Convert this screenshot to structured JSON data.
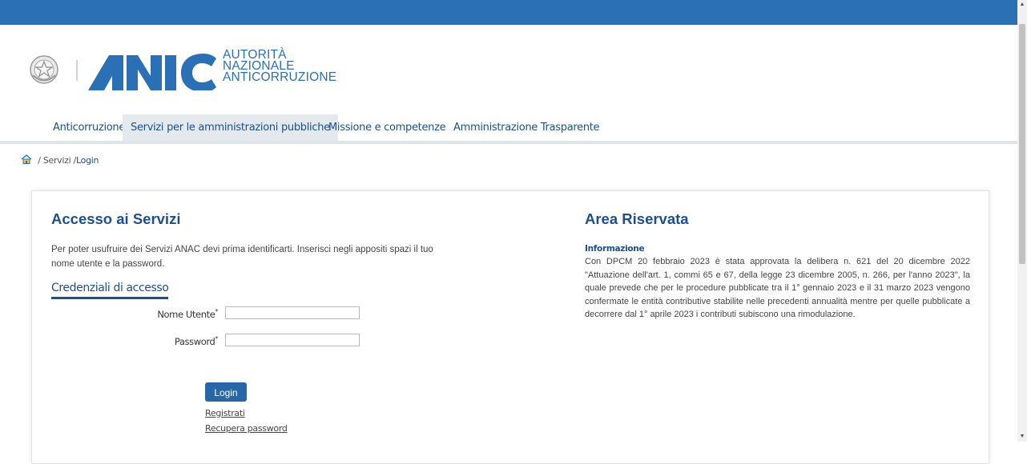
{
  "logo": {
    "brand": "ANAC",
    "line1": "AUTORITÀ",
    "line2": "NAZIONALE",
    "line3": "ANTICORRUZIONE",
    "brand_color": "#2b6fb5"
  },
  "nav": {
    "items": [
      {
        "label": "Anticorruzione"
      },
      {
        "label": "Servizi per le amministrazioni pubbliche"
      },
      {
        "label": "Missione e competenze"
      },
      {
        "label": "Amministrazione Trasparente"
      }
    ],
    "active_index": 1
  },
  "breadcrumb": {
    "home_icon": "home-icon",
    "sep1": "/",
    "item1": "Servizi",
    "sep2": "/",
    "item2": "Login"
  },
  "login": {
    "title": "Accesso ai Servizi",
    "intro": "Per poter usufruire dei Servizi ANAC devi prima identificarti. Inserisci negli appositi spazi il tuo nome utente e la password.",
    "credentials_title": "Credenziali di accesso",
    "username_label": "Nome Utente",
    "password_label": "Password",
    "required_mark": "*",
    "username_value": "",
    "password_value": "",
    "login_button": "Login",
    "register_link": "Registrati",
    "recover_link": "Recupera password"
  },
  "reserved": {
    "title": "Area Riservata",
    "info_label": "Informazione",
    "info_text": "Con DPCM 20 febbraio 2023 è stata approvata la delibera n. 621 del 20 dicembre 2022 \"Attuazione dell'art. 1, commi 65 e 67, della legge 23 dicembre 2005, n. 266, per l'anno 2023\", la quale prevede che per le procedure pubblicate tra il 1° gennaio 2023 e il 31 marzo 2023 vengono confermate le entità contributive stabilite nelle precedenti annualità mentre per quelle pubblicate a decorrere dal 1° aprile 2023 i contributi subiscono una rimodulazione."
  },
  "colors": {
    "topbar": "#2b6fb5",
    "primary": "#1d4f8a",
    "button": "#2866a8"
  }
}
